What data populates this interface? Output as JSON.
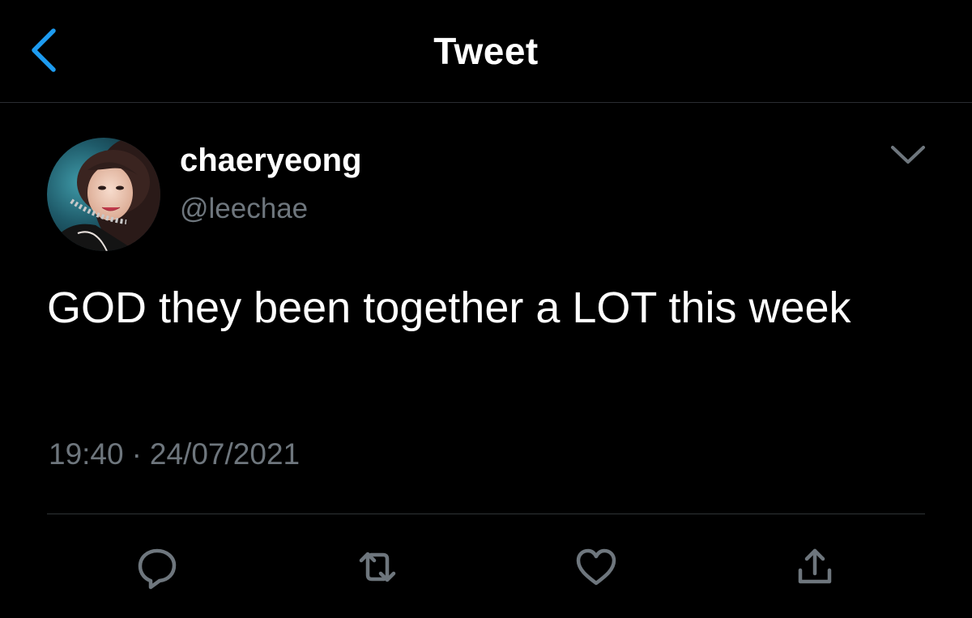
{
  "header": {
    "title": "Tweet",
    "back_icon": "chevron-left-icon"
  },
  "author": {
    "display_name": "chaeryeong",
    "handle": "@leechae",
    "avatar_icon": "profile-photo"
  },
  "tweet": {
    "text": "GOD they been together a LOT this week",
    "time": "19:40",
    "separator": "·",
    "date": "24/07/2021"
  },
  "actions": {
    "reply_icon": "reply-icon",
    "retweet_icon": "retweet-icon",
    "like_icon": "heart-icon",
    "share_icon": "share-icon"
  },
  "colors": {
    "background": "#000000",
    "accent": "#1d9bf0",
    "secondary_text": "#6e767d",
    "divider": "#2f3336"
  }
}
